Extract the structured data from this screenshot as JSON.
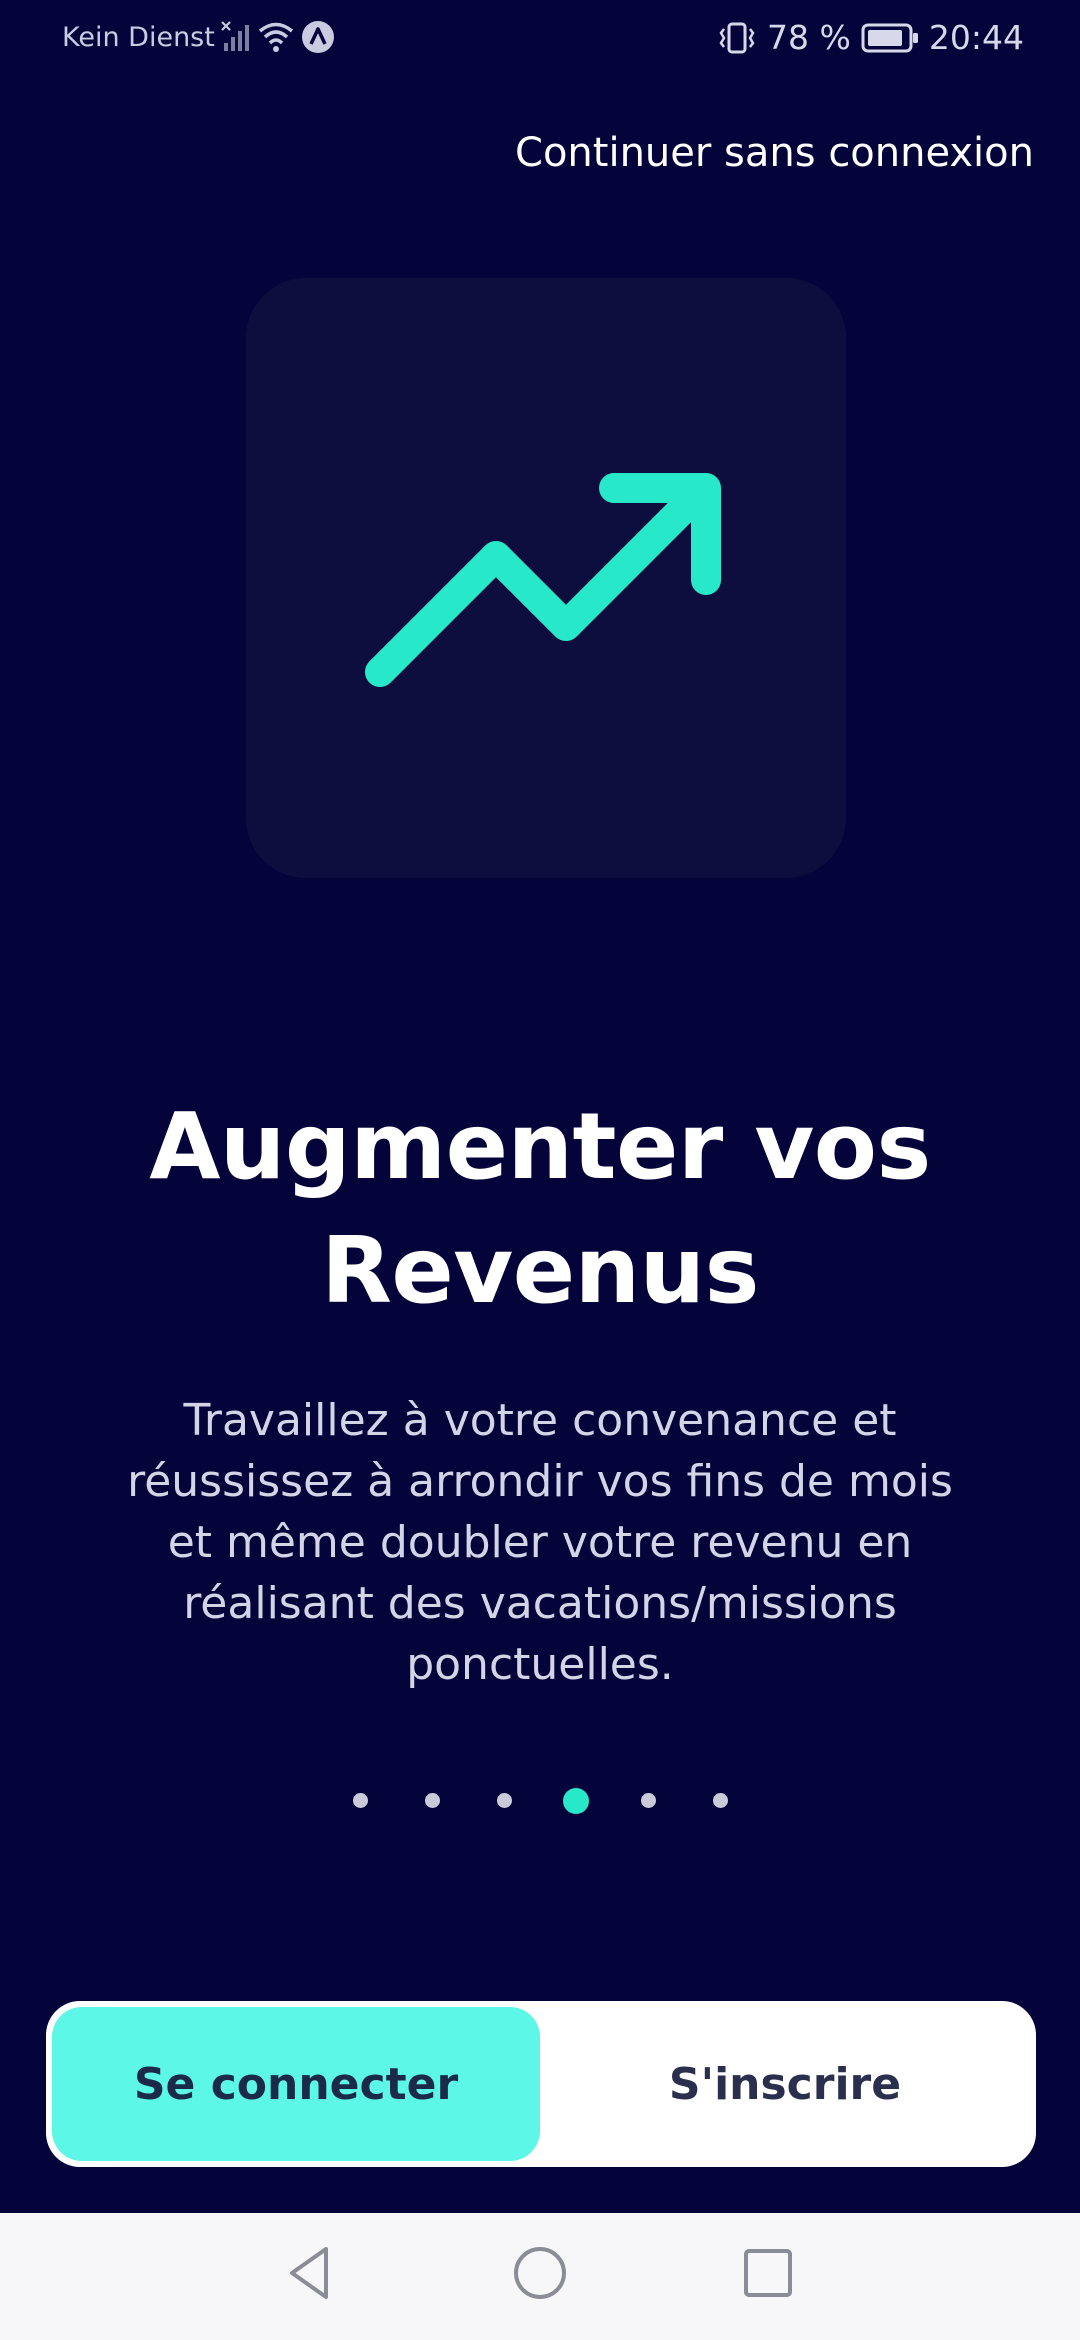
{
  "status_bar": {
    "carrier": "Kein Dienst",
    "battery_percent": "78 %",
    "time": "20:44",
    "icons": [
      "no-signal-icon",
      "wifi-icon",
      "app-notification-icon",
      "vibrate-icon",
      "battery-icon"
    ]
  },
  "skip_link": "Continuer sans connexion",
  "illustration": {
    "icon": "trending-up-arrow-icon",
    "accent": "#27E8C8"
  },
  "title": "Augmenter vos Revenus",
  "description": "Travaillez à votre convenance et réussissez à arrondir vos fins de mois et même doubler votre revenu en réalisant des vacations/missions ponctuelles.",
  "pager": {
    "total": 6,
    "active_index": 4
  },
  "buttons": {
    "login": "Se connecter",
    "signup": "S'inscrire"
  },
  "nav_bar": {
    "icons": [
      "back-icon",
      "home-icon",
      "recents-icon"
    ]
  },
  "colors": {
    "background": "#04043B",
    "card": "#0E0E3E",
    "accent": "#5CF7E6",
    "dot_active": "#27E8C8"
  }
}
